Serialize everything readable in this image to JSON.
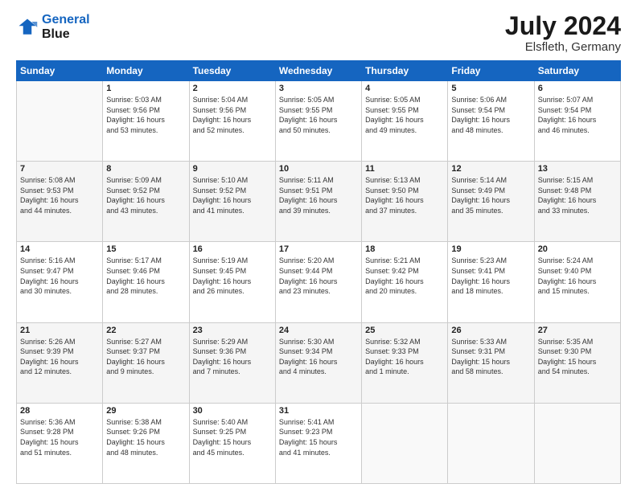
{
  "logo": {
    "line1": "General",
    "line2": "Blue"
  },
  "header": {
    "month_year": "July 2024",
    "location": "Elsfleth, Germany"
  },
  "days_of_week": [
    "Sunday",
    "Monday",
    "Tuesday",
    "Wednesday",
    "Thursday",
    "Friday",
    "Saturday"
  ],
  "weeks": [
    [
      {
        "day": "",
        "info": ""
      },
      {
        "day": "1",
        "info": "Sunrise: 5:03 AM\nSunset: 9:56 PM\nDaylight: 16 hours\nand 53 minutes."
      },
      {
        "day": "2",
        "info": "Sunrise: 5:04 AM\nSunset: 9:56 PM\nDaylight: 16 hours\nand 52 minutes."
      },
      {
        "day": "3",
        "info": "Sunrise: 5:05 AM\nSunset: 9:55 PM\nDaylight: 16 hours\nand 50 minutes."
      },
      {
        "day": "4",
        "info": "Sunrise: 5:05 AM\nSunset: 9:55 PM\nDaylight: 16 hours\nand 49 minutes."
      },
      {
        "day": "5",
        "info": "Sunrise: 5:06 AM\nSunset: 9:54 PM\nDaylight: 16 hours\nand 48 minutes."
      },
      {
        "day": "6",
        "info": "Sunrise: 5:07 AM\nSunset: 9:54 PM\nDaylight: 16 hours\nand 46 minutes."
      }
    ],
    [
      {
        "day": "7",
        "info": "Sunrise: 5:08 AM\nSunset: 9:53 PM\nDaylight: 16 hours\nand 44 minutes."
      },
      {
        "day": "8",
        "info": "Sunrise: 5:09 AM\nSunset: 9:52 PM\nDaylight: 16 hours\nand 43 minutes."
      },
      {
        "day": "9",
        "info": "Sunrise: 5:10 AM\nSunset: 9:52 PM\nDaylight: 16 hours\nand 41 minutes."
      },
      {
        "day": "10",
        "info": "Sunrise: 5:11 AM\nSunset: 9:51 PM\nDaylight: 16 hours\nand 39 minutes."
      },
      {
        "day": "11",
        "info": "Sunrise: 5:13 AM\nSunset: 9:50 PM\nDaylight: 16 hours\nand 37 minutes."
      },
      {
        "day": "12",
        "info": "Sunrise: 5:14 AM\nSunset: 9:49 PM\nDaylight: 16 hours\nand 35 minutes."
      },
      {
        "day": "13",
        "info": "Sunrise: 5:15 AM\nSunset: 9:48 PM\nDaylight: 16 hours\nand 33 minutes."
      }
    ],
    [
      {
        "day": "14",
        "info": "Sunrise: 5:16 AM\nSunset: 9:47 PM\nDaylight: 16 hours\nand 30 minutes."
      },
      {
        "day": "15",
        "info": "Sunrise: 5:17 AM\nSunset: 9:46 PM\nDaylight: 16 hours\nand 28 minutes."
      },
      {
        "day": "16",
        "info": "Sunrise: 5:19 AM\nSunset: 9:45 PM\nDaylight: 16 hours\nand 26 minutes."
      },
      {
        "day": "17",
        "info": "Sunrise: 5:20 AM\nSunset: 9:44 PM\nDaylight: 16 hours\nand 23 minutes."
      },
      {
        "day": "18",
        "info": "Sunrise: 5:21 AM\nSunset: 9:42 PM\nDaylight: 16 hours\nand 20 minutes."
      },
      {
        "day": "19",
        "info": "Sunrise: 5:23 AM\nSunset: 9:41 PM\nDaylight: 16 hours\nand 18 minutes."
      },
      {
        "day": "20",
        "info": "Sunrise: 5:24 AM\nSunset: 9:40 PM\nDaylight: 16 hours\nand 15 minutes."
      }
    ],
    [
      {
        "day": "21",
        "info": "Sunrise: 5:26 AM\nSunset: 9:39 PM\nDaylight: 16 hours\nand 12 minutes."
      },
      {
        "day": "22",
        "info": "Sunrise: 5:27 AM\nSunset: 9:37 PM\nDaylight: 16 hours\nand 9 minutes."
      },
      {
        "day": "23",
        "info": "Sunrise: 5:29 AM\nSunset: 9:36 PM\nDaylight: 16 hours\nand 7 minutes."
      },
      {
        "day": "24",
        "info": "Sunrise: 5:30 AM\nSunset: 9:34 PM\nDaylight: 16 hours\nand 4 minutes."
      },
      {
        "day": "25",
        "info": "Sunrise: 5:32 AM\nSunset: 9:33 PM\nDaylight: 16 hours\nand 1 minute."
      },
      {
        "day": "26",
        "info": "Sunrise: 5:33 AM\nSunset: 9:31 PM\nDaylight: 15 hours\nand 58 minutes."
      },
      {
        "day": "27",
        "info": "Sunrise: 5:35 AM\nSunset: 9:30 PM\nDaylight: 15 hours\nand 54 minutes."
      }
    ],
    [
      {
        "day": "28",
        "info": "Sunrise: 5:36 AM\nSunset: 9:28 PM\nDaylight: 15 hours\nand 51 minutes."
      },
      {
        "day": "29",
        "info": "Sunrise: 5:38 AM\nSunset: 9:26 PM\nDaylight: 15 hours\nand 48 minutes."
      },
      {
        "day": "30",
        "info": "Sunrise: 5:40 AM\nSunset: 9:25 PM\nDaylight: 15 hours\nand 45 minutes."
      },
      {
        "day": "31",
        "info": "Sunrise: 5:41 AM\nSunset: 9:23 PM\nDaylight: 15 hours\nand 41 minutes."
      },
      {
        "day": "",
        "info": ""
      },
      {
        "day": "",
        "info": ""
      },
      {
        "day": "",
        "info": ""
      }
    ]
  ]
}
